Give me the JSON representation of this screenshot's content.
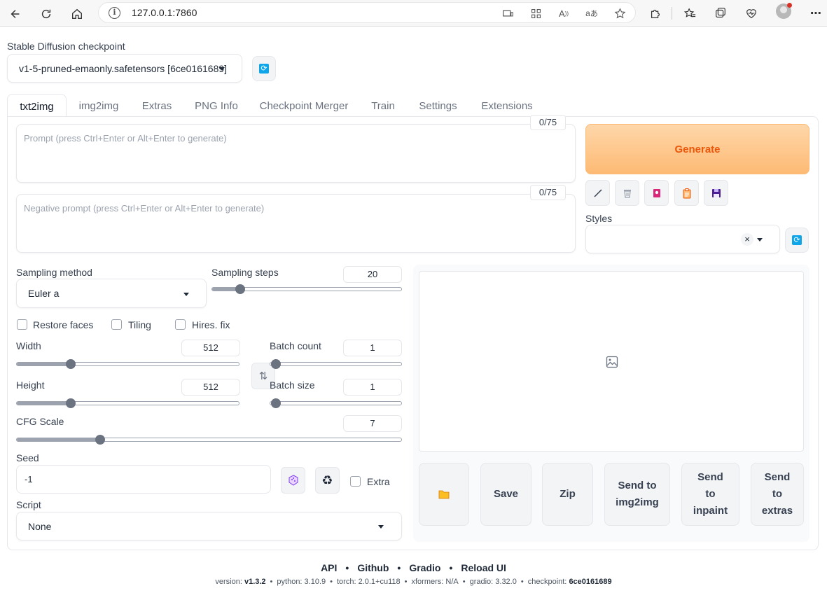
{
  "browser": {
    "url": "127.0.0.1:7860"
  },
  "checkpoint": {
    "label": "Stable Diffusion checkpoint",
    "value": "v1-5-pruned-emaonly.safetensors [6ce0161689]"
  },
  "tabs": [
    {
      "label": "txt2img",
      "active": true
    },
    {
      "label": "img2img"
    },
    {
      "label": "Extras"
    },
    {
      "label": "PNG Info"
    },
    {
      "label": "Checkpoint Merger"
    },
    {
      "label": "Train"
    },
    {
      "label": "Settings"
    },
    {
      "label": "Extensions"
    }
  ],
  "prompt": {
    "placeholder": "Prompt (press Ctrl+Enter or Alt+Enter to generate)",
    "counter": "0/75"
  },
  "negative_prompt": {
    "placeholder": "Negative prompt (press Ctrl+Enter or Alt+Enter to generate)",
    "counter": "0/75"
  },
  "generate": {
    "label": "Generate"
  },
  "styles": {
    "label": "Styles"
  },
  "sampling": {
    "method_label": "Sampling method",
    "method_value": "Euler a",
    "steps_label": "Sampling steps",
    "steps_value": "20"
  },
  "checkboxes": {
    "restore_faces": "Restore faces",
    "tiling": "Tiling",
    "hires_fix": "Hires. fix",
    "extra": "Extra"
  },
  "width": {
    "label": "Width",
    "value": "512"
  },
  "height": {
    "label": "Height",
    "value": "512"
  },
  "batch_count": {
    "label": "Batch count",
    "value": "1"
  },
  "batch_size": {
    "label": "Batch size",
    "value": "1"
  },
  "cfg_scale": {
    "label": "CFG Scale",
    "value": "7"
  },
  "seed": {
    "label": "Seed",
    "value": "-1"
  },
  "script": {
    "label": "Script",
    "value": "None"
  },
  "output_buttons": {
    "save": "Save",
    "zip": "Zip",
    "send_img2img": "Send to img2img",
    "send_inpaint": "Send to inpaint",
    "send_extras": "Send to extras"
  },
  "footer": {
    "links": [
      "API",
      "Github",
      "Gradio",
      "Reload UI"
    ],
    "version_label": "version:",
    "version": "v1.3.2",
    "python": "python: 3.10.9",
    "torch": "torch: 2.0.1+cu118",
    "xformers": "xformers: N/A",
    "gradio": "gradio: 3.32.0",
    "checkpoint_label": "checkpoint:",
    "checkpoint": "6ce0161689"
  },
  "colors": {
    "accent_orange": "#ea580c",
    "generate_bg": "#fdba74",
    "refresh_blue": "#0ea5e9"
  }
}
